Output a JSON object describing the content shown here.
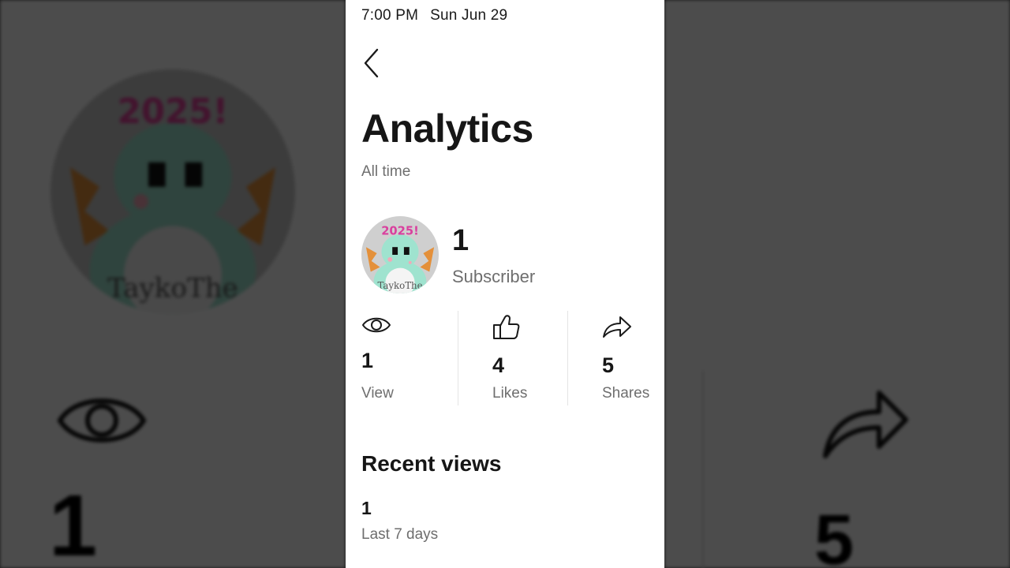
{
  "status_bar": {
    "time": "7:00 PM",
    "date": "Sun Jun 29"
  },
  "header": {
    "back_icon": "chevron-left-icon",
    "title": "Analytics",
    "subtitle": "All time"
  },
  "channel": {
    "avatar_text_top": "2025!",
    "avatar_text_bottom": "TaykoThe",
    "subscriber_count": "1",
    "subscriber_label": "Subscriber"
  },
  "stats": [
    {
      "icon": "eye-icon",
      "value": "1",
      "label": "View"
    },
    {
      "icon": "thumbs-up-icon",
      "value": "4",
      "label": "Likes"
    },
    {
      "icon": "share-icon",
      "value": "5",
      "label": "Shares"
    }
  ],
  "recent_views": {
    "title": "Recent views",
    "count": "1",
    "period": "Last 7 days"
  },
  "background": {
    "left_number": "1",
    "right_number": "5"
  },
  "colors": {
    "text_primary": "#161616",
    "text_secondary": "#6e6e6e",
    "panel_background": "#ffffff",
    "dim_overlay": "#4a4a4a"
  }
}
